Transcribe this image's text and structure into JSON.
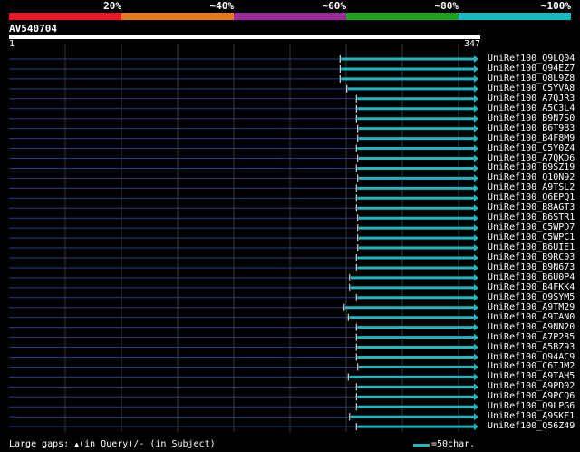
{
  "percent_labels": [
    "20%",
    "~40%",
    "~60%",
    "~80%",
    "~100%"
  ],
  "identity_colors": [
    "#e8182a",
    "#e6781e",
    "#9a2a9a",
    "#22a022",
    "#1ab8c0"
  ],
  "query": {
    "id": "AV540704",
    "start": "1",
    "end": "347",
    "length": 347
  },
  "hit_color": "#1ab8c0",
  "hits": [
    {
      "name": "UniRef100_Q9LQ04",
      "start": 245
    },
    {
      "name": "UniRef100_Q94EZ7",
      "start": 245
    },
    {
      "name": "UniRef100_Q8L9Z8",
      "start": 245
    },
    {
      "name": "UniRef100_C5YVA8",
      "start": 250
    },
    {
      "name": "UniRef100_A7QJR3",
      "start": 257
    },
    {
      "name": "UniRef100_A5C3L4",
      "start": 257
    },
    {
      "name": "UniRef100_B9N7S0",
      "start": 257
    },
    {
      "name": "UniRef100_B6T9B3",
      "start": 258
    },
    {
      "name": "UniRef100_B4F8M9",
      "start": 258
    },
    {
      "name": "UniRef100_C5Y0Z4",
      "start": 257
    },
    {
      "name": "UniRef100_A7QKD6",
      "start": 258
    },
    {
      "name": "UniRef100_B9SZ19",
      "start": 257
    },
    {
      "name": "UniRef100_Q10N92",
      "start": 258
    },
    {
      "name": "UniRef100_A9TSL2",
      "start": 257
    },
    {
      "name": "UniRef100_Q6EPQ1",
      "start": 257
    },
    {
      "name": "UniRef100_B8AGT3",
      "start": 257
    },
    {
      "name": "UniRef100_B6STR1",
      "start": 258
    },
    {
      "name": "UniRef100_C5WPD7",
      "start": 258
    },
    {
      "name": "UniRef100_C5WPC1",
      "start": 258
    },
    {
      "name": "UniRef100_B6UIE1",
      "start": 258
    },
    {
      "name": "UniRef100_B9RC03",
      "start": 257
    },
    {
      "name": "UniRef100_B9N673",
      "start": 257
    },
    {
      "name": "UniRef100_B6U0P4",
      "start": 252
    },
    {
      "name": "UniRef100_B4FKK4",
      "start": 252
    },
    {
      "name": "UniRef100_Q9SYM5",
      "start": 257
    },
    {
      "name": "UniRef100_A9TM29",
      "start": 248
    },
    {
      "name": "UniRef100_A9TAN0",
      "start": 251
    },
    {
      "name": "UniRef100_A9NN20",
      "start": 257
    },
    {
      "name": "UniRef100_A7P285",
      "start": 257
    },
    {
      "name": "UniRef100_A5BZ93",
      "start": 257
    },
    {
      "name": "UniRef100_Q94AC9",
      "start": 257
    },
    {
      "name": "UniRef100_C6TJM2",
      "start": 258
    },
    {
      "name": "UniRef100_A9TAH5",
      "start": 251
    },
    {
      "name": "UniRef100_A9PD02",
      "start": 257
    },
    {
      "name": "UniRef100_A9PCQ6",
      "start": 257
    },
    {
      "name": "UniRef100_Q9LPG6",
      "start": 257
    },
    {
      "name": "UniRef100_A9SKF1",
      "start": 252
    },
    {
      "name": "UniRef100_Q56Z49",
      "start": 257
    }
  ],
  "footer": {
    "gaps_prefix": "Large gaps:",
    "gaps_query": "(in Query)/",
    "gaps_subject": "- (in Subject)",
    "scale_label": "=50char."
  }
}
